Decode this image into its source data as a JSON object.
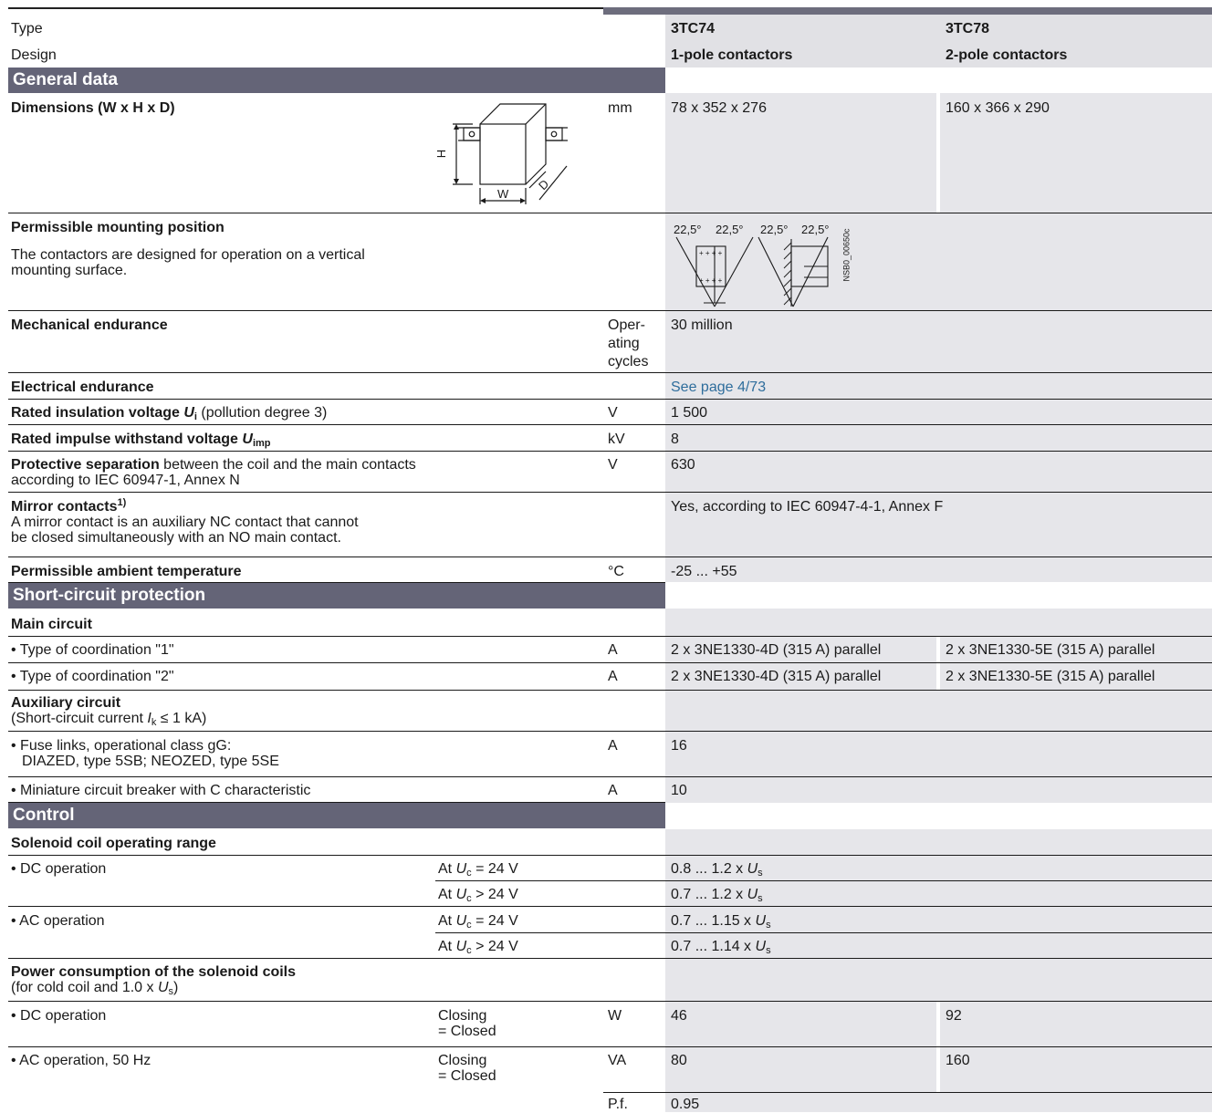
{
  "header": {
    "type_label": "Type",
    "design_label": "Design",
    "col1_type": "3TC74",
    "col2_type": "3TC78",
    "col1_design": "1-pole contactors",
    "col2_design": "2-pole contactors"
  },
  "sections": {
    "general": "General data",
    "short_circuit": "Short-circuit protection",
    "control": "Control"
  },
  "general": {
    "dimensions_label": "Dimensions (W x H x D)",
    "dimensions_unit": "mm",
    "dimensions_col1": "78 x 352 x 276",
    "dimensions_col2": "160 x 366 x 290",
    "dim_h": "H",
    "dim_w": "W",
    "dim_d": "D",
    "mounting_label": "Permissible mounting position",
    "mounting_desc1": "The contactors are designed for operation on a vertical",
    "mounting_desc2": "mounting surface.",
    "mount_angle1": "22,5°",
    "mount_angle2": "22,5°",
    "mount_angle3": "22,5°",
    "mount_angle4": "22,5°",
    "mount_code": "NSB0_00650c",
    "mech_label": "Mechanical endurance",
    "mech_unit1": "Oper-",
    "mech_unit2": "ating",
    "mech_unit3": "cycles",
    "mech_value": "30 million",
    "elec_label": "Electrical endurance",
    "elec_value": "See page 4/73",
    "insul_label_bold": "Rated insulation voltage ",
    "insul_sym": "U",
    "insul_sub": "i",
    "insul_label_rest": " (pollution degree 3)",
    "insul_unit": "V",
    "insul_value": "1 500",
    "impulse_label_bold": "Rated impulse withstand voltage ",
    "impulse_sym": "U",
    "impulse_sub": "imp",
    "impulse_unit": "kV",
    "impulse_value": "8",
    "protsep_bold": "Protective separation",
    "protsep_rest": " between the coil and the main contacts",
    "protsep_line2": "according to IEC 60947-1, Annex N",
    "protsep_unit": "V",
    "protsep_value": "630",
    "mirror_label": "Mirror contacts",
    "mirror_sup": "1)",
    "mirror_desc1": "A mirror contact is an auxiliary NC contact that cannot",
    "mirror_desc2": "be closed simultaneously with an NO main contact.",
    "mirror_value": "Yes, according to IEC 60947-4-1, Annex F",
    "temp_label": "Permissible ambient temperature",
    "temp_unit": "°C",
    "temp_value": "-25 ... +55"
  },
  "short_circuit": {
    "main_circuit": "Main circuit",
    "coord1_label": "• Type of coordination \"1\"",
    "coord1_unit": "A",
    "coord1_col1": "2 x 3NE1330-4D (315 A) parallel",
    "coord1_col2": "2 x 3NE1330-5E (315 A) parallel",
    "coord2_label": "• Type of coordination \"2\"",
    "coord2_unit": "A",
    "coord2_col1": "2 x 3NE1330-4D (315 A) parallel",
    "coord2_col2": "2 x 3NE1330-5E (315 A) parallel",
    "aux_label": "Auxiliary circuit",
    "aux_desc_pre": "(Short-circuit current ",
    "aux_desc_sym": "I",
    "aux_desc_sub": "k",
    "aux_desc_post": " ≤ 1 kA)",
    "fuse_line1": "• Fuse links, operational class gG:",
    "fuse_line2": "DIAZED, type 5SB; NEOZED, type 5SE",
    "fuse_unit": "A",
    "fuse_value": "16",
    "mcb_label": "• Miniature circuit breaker with C characteristic",
    "mcb_unit": "A",
    "mcb_value": "10"
  },
  "control": {
    "solenoid_label": "Solenoid coil operating range",
    "dc_op": "• DC operation",
    "ac_op": "• AC operation",
    "at": "At ",
    "uc_sym": "U",
    "uc_sub": "c",
    "eq24": " = 24 V",
    "gt24": " > 24 V",
    "us_sym": "U",
    "us_sub": "s",
    "dc_eq_range": "0.8 ... 1.2 x ",
    "dc_gt_range": "0.7 ... 1.2 x ",
    "ac_eq_range": "0.7 ... 1.15 x ",
    "ac_gt_range": "0.7 ... 1.14 x ",
    "power_label": "Power consumption of the solenoid coils",
    "power_desc_pre": "(for cold coil and 1.0 x ",
    "power_desc_post": ")",
    "dc_power_label": "• DC operation",
    "ac_power_label": "• AC operation, 50 Hz",
    "closing": "Closing",
    "closed": "= Closed",
    "dc_unit": "W",
    "dc_col1": "46",
    "dc_col2": "92",
    "ac_unit": "VA",
    "ac_col1": "80",
    "ac_col2": "160",
    "pf_unit": "P.f.",
    "pf_value": "0.95"
  }
}
